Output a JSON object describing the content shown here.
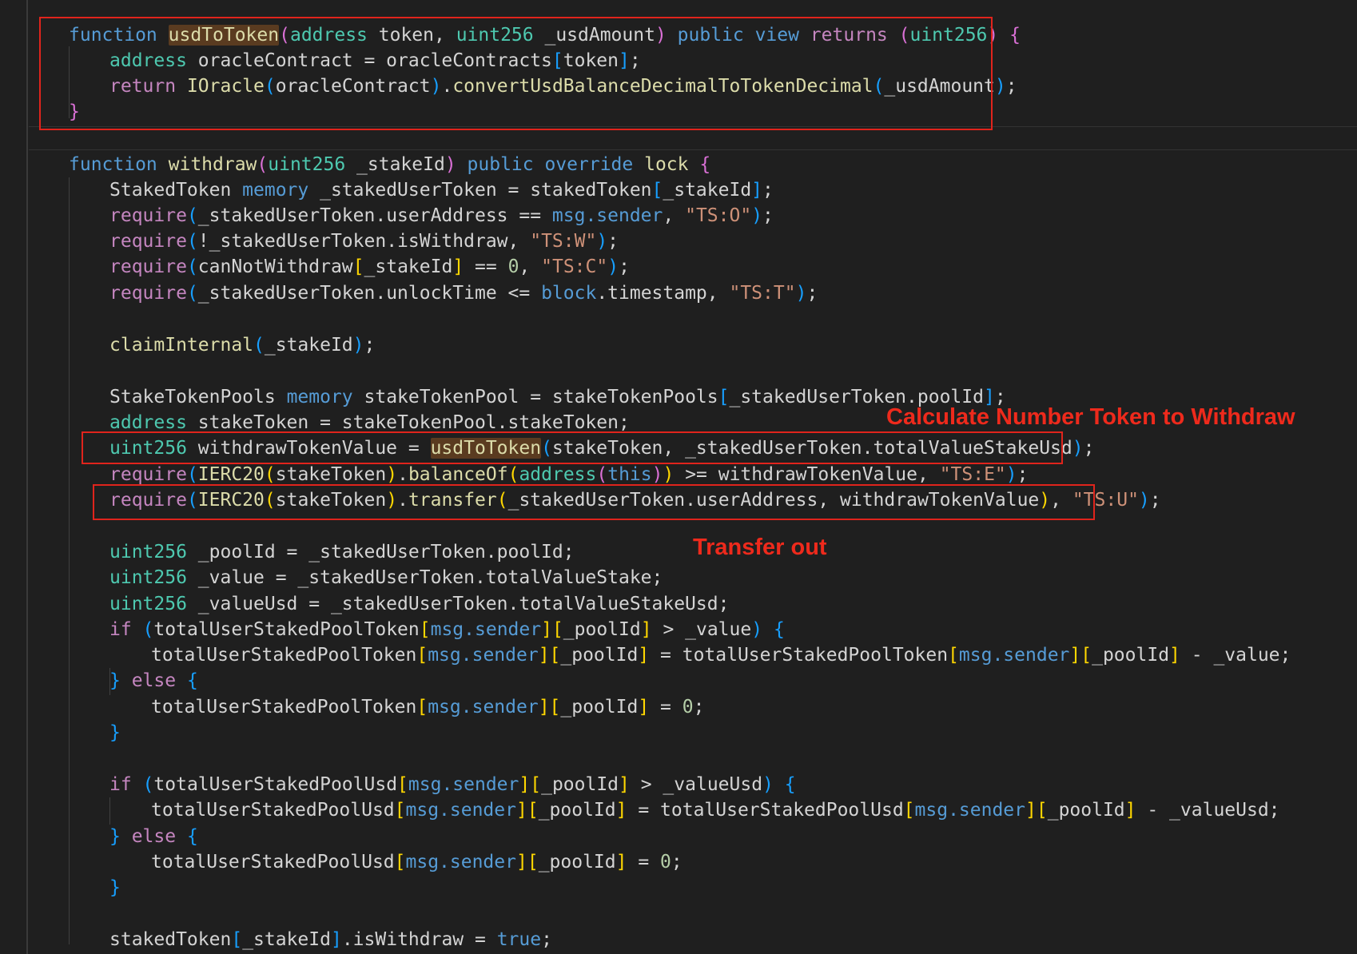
{
  "colors": {
    "background": "#1f1f1f",
    "highlight_box": "#e0241c",
    "annotation_text": "#ee2a1c",
    "keyword": "#569cd6",
    "control": "#c586c0",
    "function": "#dcdcaa",
    "type": "#4ec9b0",
    "string": "#ce9178",
    "number": "#b5cea8"
  },
  "annotations": {
    "calculate": "Calculate Number Token to Withdraw",
    "transfer": "Transfer out"
  },
  "code": [
    [
      [
        "kw",
        "function "
      ],
      [
        "fn",
        "usdToToken",
        "hl"
      ],
      [
        "b1",
        "("
      ],
      [
        "ty",
        "address "
      ],
      [
        "id",
        "token, "
      ],
      [
        "ty",
        "uint256 "
      ],
      [
        "id",
        "_usdAmount"
      ],
      [
        "b1",
        ")"
      ],
      [
        "kw",
        " public view "
      ],
      [
        "ctl",
        "returns "
      ],
      [
        "b1",
        "("
      ],
      [
        "ty",
        "uint256"
      ],
      [
        "b1",
        ")"
      ],
      [
        "id",
        " "
      ],
      [
        "b1",
        "{"
      ]
    ],
    [
      [
        "ty",
        "address "
      ],
      [
        "id",
        "oracleContract = oracleContracts"
      ],
      [
        "b2",
        "["
      ],
      [
        "id",
        "token"
      ],
      [
        "b2",
        "]"
      ],
      [
        "id",
        ";"
      ]
    ],
    [
      [
        "ctl",
        "return "
      ],
      [
        "fn",
        "IOracle"
      ],
      [
        "b2",
        "("
      ],
      [
        "id",
        "oracleContract"
      ],
      [
        "b2",
        ")"
      ],
      [
        "id",
        "."
      ],
      [
        "fn",
        "convertUsdBalanceDecimalToTokenDecimal"
      ],
      [
        "b2",
        "("
      ],
      [
        "id",
        "_usdAmount"
      ],
      [
        "b2",
        ")"
      ],
      [
        "id",
        ";"
      ]
    ],
    [
      [
        "b1",
        "}"
      ]
    ],
    [
      [
        "kw",
        "function "
      ],
      [
        "fn",
        "withdraw"
      ],
      [
        "b1",
        "("
      ],
      [
        "ty",
        "uint256 "
      ],
      [
        "id",
        "_stakeId"
      ],
      [
        "b1",
        ")"
      ],
      [
        "kw",
        " public override "
      ],
      [
        "fn",
        "lock"
      ],
      [
        "id",
        " "
      ],
      [
        "b1",
        "{"
      ]
    ],
    [
      [
        "id",
        "StakedToken "
      ],
      [
        "kw",
        "memory "
      ],
      [
        "id",
        "_stakedUserToken = stakedToken"
      ],
      [
        "b2",
        "["
      ],
      [
        "id",
        "_stakeId"
      ],
      [
        "b2",
        "]"
      ],
      [
        "id",
        ";"
      ]
    ],
    [
      [
        "ctl",
        "require"
      ],
      [
        "b2",
        "("
      ],
      [
        "id",
        "_stakedUserToken.userAddress == "
      ],
      [
        "kw",
        "msg.sender"
      ],
      [
        "id",
        ", "
      ],
      [
        "str",
        "\"TS:O\""
      ],
      [
        "b2",
        ")"
      ],
      [
        "id",
        ";"
      ]
    ],
    [
      [
        "ctl",
        "require"
      ],
      [
        "b2",
        "("
      ],
      [
        "id",
        "!_stakedUserToken.isWithdraw, "
      ],
      [
        "str",
        "\"TS:W\""
      ],
      [
        "b2",
        ")"
      ],
      [
        "id",
        ";"
      ]
    ],
    [
      [
        "ctl",
        "require"
      ],
      [
        "b2",
        "("
      ],
      [
        "id",
        "canNotWithdraw"
      ],
      [
        "b3",
        "["
      ],
      [
        "id",
        "_stakeId"
      ],
      [
        "b3",
        "]"
      ],
      [
        "id",
        " == "
      ],
      [
        "num",
        "0"
      ],
      [
        "id",
        ", "
      ],
      [
        "str",
        "\"TS:C\""
      ],
      [
        "b2",
        ")"
      ],
      [
        "id",
        ";"
      ]
    ],
    [
      [
        "ctl",
        "require"
      ],
      [
        "b2",
        "("
      ],
      [
        "id",
        "_stakedUserToken.unlockTime <= "
      ],
      [
        "kw",
        "block"
      ],
      [
        "id",
        ".timestamp, "
      ],
      [
        "str",
        "\"TS:T\""
      ],
      [
        "b2",
        ")"
      ],
      [
        "id",
        ";"
      ]
    ],
    [
      [
        "fn",
        "claimInternal"
      ],
      [
        "b2",
        "("
      ],
      [
        "id",
        "_stakeId"
      ],
      [
        "b2",
        ")"
      ],
      [
        "id",
        ";"
      ]
    ],
    [
      [
        "id",
        "StakeTokenPools "
      ],
      [
        "kw",
        "memory "
      ],
      [
        "id",
        "stakeTokenPool = stakeTokenPools"
      ],
      [
        "b2",
        "["
      ],
      [
        "id",
        "_stakedUserToken.poolId"
      ],
      [
        "b2",
        "]"
      ],
      [
        "id",
        ";"
      ]
    ],
    [
      [
        "ty",
        "address "
      ],
      [
        "id",
        "stakeToken = stakeTokenPool.stakeToken;"
      ]
    ],
    [
      [
        "ty",
        "uint256 "
      ],
      [
        "id",
        "withdrawTokenValue = "
      ],
      [
        "fn",
        "usdToToken",
        "hl"
      ],
      [
        "b2",
        "("
      ],
      [
        "id",
        "stakeToken, _stakedUserToken.totalValueStakeUsd"
      ],
      [
        "b2",
        ")"
      ],
      [
        "id",
        ";"
      ]
    ],
    [
      [
        "ctl",
        "require"
      ],
      [
        "b2",
        "("
      ],
      [
        "fn",
        "IERC20"
      ],
      [
        "b3",
        "("
      ],
      [
        "id",
        "stakeToken"
      ],
      [
        "b3",
        ")"
      ],
      [
        "id",
        "."
      ],
      [
        "fn",
        "balanceOf"
      ],
      [
        "b3",
        "("
      ],
      [
        "ty",
        "address"
      ],
      [
        "b1",
        "("
      ],
      [
        "kw",
        "this"
      ],
      [
        "b1",
        ")"
      ],
      [
        "b3",
        ")"
      ],
      [
        "id",
        " >= withdrawTokenValue, "
      ],
      [
        "str",
        "\"TS:E\""
      ],
      [
        "b2",
        ")"
      ],
      [
        "id",
        ";"
      ]
    ],
    [
      [
        "ctl",
        "require"
      ],
      [
        "b2",
        "("
      ],
      [
        "fn",
        "IERC20"
      ],
      [
        "b3",
        "("
      ],
      [
        "id",
        "stakeToken"
      ],
      [
        "b3",
        ")"
      ],
      [
        "id",
        "."
      ],
      [
        "fn",
        "transfer"
      ],
      [
        "b3",
        "("
      ],
      [
        "id",
        "_stakedUserToken.userAddress, withdrawTokenValue"
      ],
      [
        "b3",
        ")"
      ],
      [
        "id",
        ", "
      ],
      [
        "str",
        "\"TS:U\""
      ],
      [
        "b2",
        ")"
      ],
      [
        "id",
        ";"
      ]
    ],
    [
      [
        "ty",
        "uint256 "
      ],
      [
        "id",
        "_poolId = _stakedUserToken.poolId;"
      ]
    ],
    [
      [
        "ty",
        "uint256 "
      ],
      [
        "id",
        "_value = _stakedUserToken.totalValueStake;"
      ]
    ],
    [
      [
        "ty",
        "uint256 "
      ],
      [
        "id",
        "_valueUsd = _stakedUserToken.totalValueStakeUsd;"
      ]
    ],
    [
      [
        "ctl",
        "if "
      ],
      [
        "b2",
        "("
      ],
      [
        "id",
        "totalUserStakedPoolToken"
      ],
      [
        "b3",
        "["
      ],
      [
        "kw",
        "msg.sender"
      ],
      [
        "b3",
        "]["
      ],
      [
        "id",
        "_poolId"
      ],
      [
        "b3",
        "]"
      ],
      [
        "id",
        " > _value"
      ],
      [
        "b2",
        ")"
      ],
      [
        "id",
        " "
      ],
      [
        "b2",
        "{"
      ]
    ],
    [
      [
        "id",
        "totalUserStakedPoolToken"
      ],
      [
        "b3",
        "["
      ],
      [
        "kw",
        "msg.sender"
      ],
      [
        "b3",
        "]["
      ],
      [
        "id",
        "_poolId"
      ],
      [
        "b3",
        "]"
      ],
      [
        "id",
        " = totalUserStakedPoolToken"
      ],
      [
        "b3",
        "["
      ],
      [
        "kw",
        "msg.sender"
      ],
      [
        "b3",
        "]["
      ],
      [
        "id",
        "_poolId"
      ],
      [
        "b3",
        "]"
      ],
      [
        "id",
        " - _value;"
      ]
    ],
    [
      [
        "b2",
        "}"
      ],
      [
        "ctl",
        " else "
      ],
      [
        "b2",
        "{"
      ]
    ],
    [
      [
        "id",
        "totalUserStakedPoolToken"
      ],
      [
        "b3",
        "["
      ],
      [
        "kw",
        "msg.sender"
      ],
      [
        "b3",
        "]["
      ],
      [
        "id",
        "_poolId"
      ],
      [
        "b3",
        "]"
      ],
      [
        "id",
        " = "
      ],
      [
        "num",
        "0"
      ],
      [
        "id",
        ";"
      ]
    ],
    [
      [
        "b2",
        "}"
      ]
    ],
    [
      [
        "ctl",
        "if "
      ],
      [
        "b2",
        "("
      ],
      [
        "id",
        "totalUserStakedPoolUsd"
      ],
      [
        "b3",
        "["
      ],
      [
        "kw",
        "msg.sender"
      ],
      [
        "b3",
        "]["
      ],
      [
        "id",
        "_poolId"
      ],
      [
        "b3",
        "]"
      ],
      [
        "id",
        " > _valueUsd"
      ],
      [
        "b2",
        ")"
      ],
      [
        "id",
        " "
      ],
      [
        "b2",
        "{"
      ]
    ],
    [
      [
        "id",
        "totalUserStakedPoolUsd"
      ],
      [
        "b3",
        "["
      ],
      [
        "kw",
        "msg.sender"
      ],
      [
        "b3",
        "]["
      ],
      [
        "id",
        "_poolId"
      ],
      [
        "b3",
        "]"
      ],
      [
        "id",
        " = totalUserStakedPoolUsd"
      ],
      [
        "b3",
        "["
      ],
      [
        "kw",
        "msg.sender"
      ],
      [
        "b3",
        "]["
      ],
      [
        "id",
        "_poolId"
      ],
      [
        "b3",
        "]"
      ],
      [
        "id",
        " - _valueUsd;"
      ]
    ],
    [
      [
        "b2",
        "}"
      ],
      [
        "ctl",
        " else "
      ],
      [
        "b2",
        "{"
      ]
    ],
    [
      [
        "id",
        "totalUserStakedPoolUsd"
      ],
      [
        "b3",
        "["
      ],
      [
        "kw",
        "msg.sender"
      ],
      [
        "b3",
        "]["
      ],
      [
        "id",
        "_poolId"
      ],
      [
        "b3",
        "]"
      ],
      [
        "id",
        " = "
      ],
      [
        "num",
        "0"
      ],
      [
        "id",
        ";"
      ]
    ],
    [
      [
        "b2",
        "}"
      ]
    ],
    [
      [
        "id",
        "stakedToken"
      ],
      [
        "b2",
        "["
      ],
      [
        "id",
        "_stakeId"
      ],
      [
        "b2",
        "]"
      ],
      [
        "id",
        ".isWithdraw = "
      ],
      [
        "kw",
        "true"
      ],
      [
        "id",
        ";"
      ]
    ]
  ]
}
